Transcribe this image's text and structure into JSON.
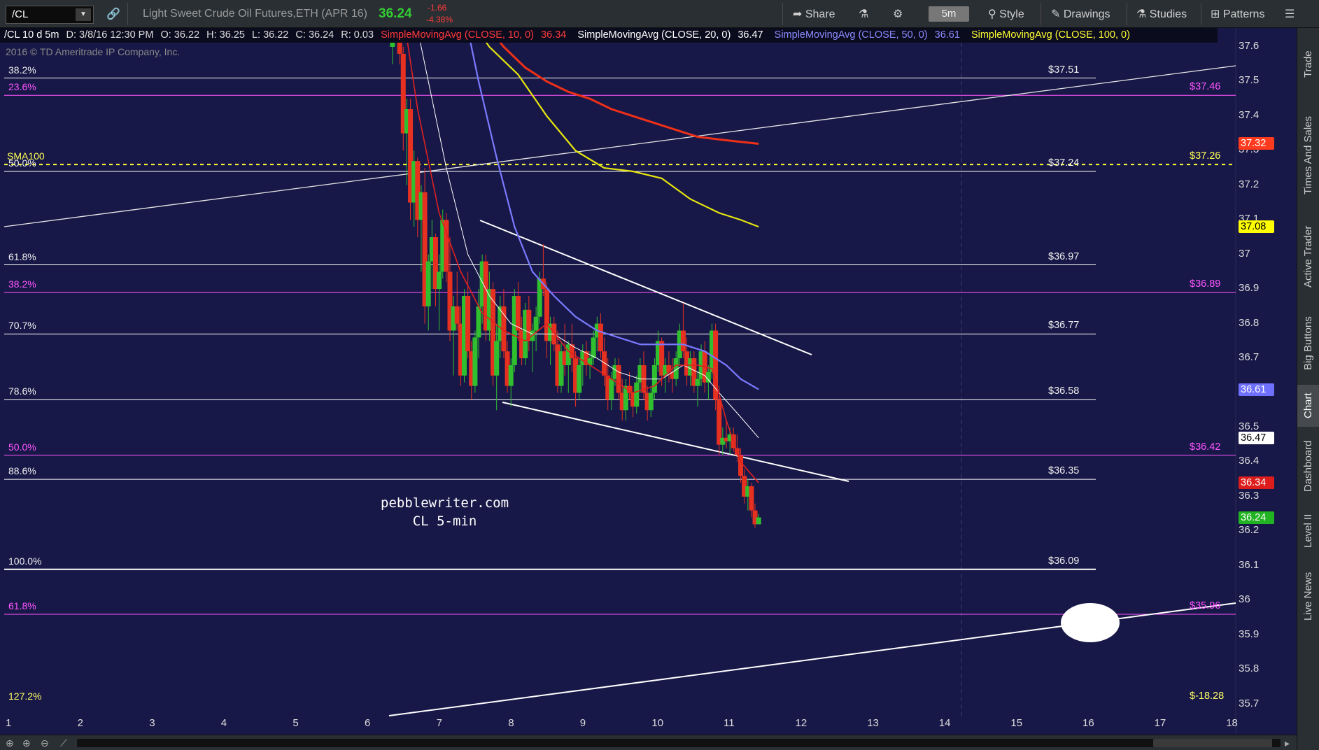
{
  "toolbar": {
    "symbol": "/CL",
    "instrument_name": "Light Sweet Crude Oil Futures,ETH (APR 16)",
    "last_price": "36.24",
    "net_change": "-1.66",
    "pct_change": "-4.38%",
    "share_label": "Share",
    "timeframe": "5m",
    "style_label": "Style",
    "drawings_label": "Drawings",
    "studies_label": "Studies",
    "patterns_label": "Patterns"
  },
  "header": {
    "symbol_period": "/CL 10 d 5m",
    "date": "D: 3/8/16 12:30 PM",
    "open": "O: 36.22",
    "high": "H: 36.25",
    "low": "L: 36.22",
    "close": "C: 36.24",
    "range": "R: 0.03",
    "studies": [
      {
        "label": "SimpleMovingAvg (CLOSE, 10, 0)",
        "value": "36.34",
        "color": "#ff2b2b"
      },
      {
        "label": "SimpleMovingAvg (CLOSE, 20, 0)",
        "value": "36.47",
        "color": "#ffffff"
      },
      {
        "label": "SimpleMovingAvg (CLOSE, 50, 0)",
        "value": "36.61",
        "color": "#8080ff"
      },
      {
        "label": "SimpleMovingAvg (CLOSE, 100, 0)",
        "value": "",
        "color": "#ffff00"
      }
    ]
  },
  "copyright": "2016 © TD Ameritrade IP Company, Inc.",
  "watermark": {
    "line1": "pebblewriter.com",
    "line2": "CL 5-min"
  },
  "fib_levels": [
    {
      "label": "38.2%",
      "price_label": "$37.51",
      "price": 37.51,
      "color": "#ffffff"
    },
    {
      "label": "23.6%",
      "price_label": "$37.46",
      "price": 37.46,
      "color": "#ff55ff"
    },
    {
      "label": "50.0%",
      "price_label": "$37.24",
      "price": 37.24,
      "color": "#ffffff"
    },
    {
      "label": "61.8%",
      "price_label": "$36.97",
      "price": 36.97,
      "color": "#ffffff"
    },
    {
      "label": "38.2%",
      "price_label": "$36.89",
      "price": 36.89,
      "color": "#ff55ff"
    },
    {
      "label": "70.7%",
      "price_label": "$36.77",
      "price": 36.77,
      "color": "#ffffff"
    },
    {
      "label": "78.6%",
      "price_label": "$36.58",
      "price": 36.58,
      "color": "#ffffff"
    },
    {
      "label": "50.0%",
      "price_label": "$36.42",
      "price": 36.42,
      "color": "#ff55ff"
    },
    {
      "label": "88.6%",
      "price_label": "$36.35",
      "price": 36.35,
      "color": "#ffffff"
    },
    {
      "label": "100.0%",
      "price_label": "$36.09",
      "price": 36.09,
      "color": "#ffffff"
    },
    {
      "label": "61.8%",
      "price_label": "$35.96",
      "price": 35.96,
      "color": "#ff55ff"
    },
    {
      "label": "127.2%",
      "price_label": "$-18.28",
      "price": 35.7,
      "color": "#ffff66"
    }
  ],
  "sma100_tag": {
    "label": "SMA100",
    "price_label": "$37.26",
    "price": 37.26
  },
  "y_axis": [
    "37.6",
    "37.5",
    "37.4",
    "37.3",
    "37.2",
    "37.1",
    "37",
    "36.9",
    "36.8",
    "36.7",
    "36.6",
    "36.5",
    "36.4",
    "36.3",
    "36.2",
    "36.1",
    "36",
    "35.9",
    "35.8",
    "35.7"
  ],
  "x_axis": [
    "1",
    "2",
    "3",
    "4",
    "5",
    "6",
    "7",
    "8",
    "9",
    "10",
    "11",
    "12",
    "13",
    "14",
    "15",
    "16",
    "17",
    "18"
  ],
  "axis_tags": [
    {
      "value": "37.32",
      "bg": "#ff3b1f",
      "fg": "#ffffff"
    },
    {
      "value": "37.08",
      "bg": "#ffff00",
      "fg": "#000000"
    },
    {
      "value": "36.61",
      "bg": "#7070ff",
      "fg": "#ffffff"
    },
    {
      "value": "36.47",
      "bg": "#ffffff",
      "fg": "#000000"
    },
    {
      "value": "36.34",
      "bg": "#dd1c1c",
      "fg": "#ffffff"
    },
    {
      "value": "36.24",
      "bg": "#22b322",
      "fg": "#ffffff"
    }
  ],
  "side_tabs": [
    "Trade",
    "Times And Sales",
    "Active Trader",
    "Big Buttons",
    "Chart",
    "Dashboard",
    "Level II",
    "Live News"
  ],
  "chart_data": {
    "type": "candlestick",
    "x_unit": "hour",
    "ylim": [
      35.7,
      37.65
    ],
    "candles": [
      [
        6.35,
        37.6,
        37.66,
        37.55,
        37.62
      ],
      [
        6.45,
        37.62,
        37.66,
        37.55,
        37.58
      ],
      [
        6.5,
        37.58,
        37.6,
        37.3,
        37.35
      ],
      [
        6.55,
        37.35,
        37.45,
        37.2,
        37.42
      ],
      [
        6.6,
        37.42,
        37.45,
        37.1,
        37.15
      ],
      [
        6.65,
        37.15,
        37.3,
        37.08,
        37.27
      ],
      [
        6.7,
        37.27,
        37.28,
        37.05,
        37.1
      ],
      [
        6.75,
        37.1,
        37.2,
        36.95,
        37.18
      ],
      [
        6.8,
        37.18,
        37.25,
        36.8,
        36.85
      ],
      [
        6.85,
        36.85,
        37.0,
        36.78,
        36.98
      ],
      [
        6.9,
        36.98,
        37.1,
        36.9,
        37.05
      ],
      [
        6.95,
        37.05,
        37.06,
        36.85,
        36.9
      ],
      [
        7.0,
        36.9,
        37.0,
        36.78,
        36.95
      ],
      [
        7.05,
        36.95,
        37.13,
        36.93,
        37.1
      ],
      [
        7.1,
        37.1,
        37.12,
        36.92,
        36.95
      ],
      [
        7.15,
        36.95,
        37.05,
        36.75,
        36.78
      ],
      [
        7.2,
        36.78,
        36.88,
        36.65,
        36.85
      ],
      [
        7.25,
        36.85,
        36.95,
        36.78,
        36.8
      ],
      [
        7.3,
        36.8,
        36.85,
        36.62,
        36.65
      ],
      [
        7.35,
        36.65,
        36.9,
        36.63,
        36.88
      ],
      [
        7.4,
        36.88,
        36.95,
        36.7,
        36.72
      ],
      [
        7.45,
        36.72,
        36.75,
        36.58,
        36.62
      ],
      [
        7.5,
        36.62,
        36.78,
        36.6,
        36.76
      ],
      [
        7.55,
        36.76,
        36.9,
        36.7,
        36.85
      ],
      [
        7.6,
        36.85,
        37.0,
        36.8,
        36.98
      ],
      [
        7.65,
        36.98,
        37.0,
        36.75,
        36.78
      ],
      [
        7.7,
        36.78,
        36.95,
        36.75,
        36.9
      ],
      [
        7.75,
        36.9,
        36.92,
        36.62,
        36.65
      ],
      [
        7.8,
        36.65,
        36.8,
        36.55,
        36.75
      ],
      [
        7.85,
        36.75,
        36.88,
        36.7,
        36.85
      ],
      [
        7.9,
        36.85,
        36.9,
        36.7,
        36.72
      ],
      [
        7.95,
        36.72,
        36.75,
        36.6,
        36.62
      ],
      [
        8.0,
        36.62,
        36.7,
        36.56,
        36.68
      ],
      [
        8.05,
        36.68,
        36.9,
        36.66,
        36.88
      ],
      [
        8.1,
        36.88,
        36.92,
        36.75,
        36.78
      ],
      [
        8.15,
        36.78,
        36.82,
        36.68,
        36.7
      ],
      [
        8.2,
        36.7,
        36.86,
        36.68,
        36.84
      ],
      [
        8.25,
        36.84,
        36.88,
        36.72,
        36.75
      ],
      [
        8.3,
        36.75,
        36.8,
        36.66,
        36.78
      ],
      [
        8.35,
        36.78,
        36.85,
        36.72,
        36.82
      ],
      [
        8.4,
        36.82,
        36.95,
        36.8,
        36.93
      ],
      [
        8.45,
        36.93,
        37.03,
        36.88,
        36.9
      ],
      [
        8.5,
        36.9,
        36.92,
        36.7,
        36.75
      ],
      [
        8.55,
        36.75,
        36.82,
        36.68,
        36.8
      ],
      [
        8.6,
        36.8,
        36.82,
        36.72,
        36.74
      ],
      [
        8.65,
        36.74,
        36.78,
        36.6,
        36.62
      ],
      [
        8.7,
        36.62,
        36.75,
        36.6,
        36.72
      ],
      [
        8.75,
        36.72,
        36.8,
        36.65,
        36.68
      ],
      [
        8.8,
        36.68,
        36.75,
        36.6,
        36.74
      ],
      [
        8.85,
        36.74,
        36.8,
        36.66,
        36.7
      ],
      [
        8.9,
        36.7,
        36.72,
        36.56,
        36.6
      ],
      [
        8.95,
        36.6,
        36.7,
        36.58,
        36.68
      ],
      [
        9.0,
        36.68,
        36.74,
        36.62,
        36.72
      ],
      [
        9.05,
        36.72,
        36.75,
        36.65,
        36.68
      ],
      [
        9.1,
        36.68,
        36.72,
        36.64,
        36.7
      ],
      [
        9.15,
        36.7,
        36.78,
        36.68,
        36.76
      ],
      [
        9.2,
        36.76,
        36.82,
        36.72,
        36.8
      ],
      [
        9.25,
        36.8,
        36.83,
        36.7,
        36.72
      ],
      [
        9.3,
        36.72,
        36.76,
        36.62,
        36.65
      ],
      [
        9.35,
        36.65,
        36.7,
        36.55,
        36.58
      ],
      [
        9.4,
        36.58,
        36.66,
        36.55,
        36.64
      ],
      [
        9.45,
        36.64,
        36.7,
        36.62,
        36.68
      ],
      [
        9.5,
        36.68,
        36.7,
        36.58,
        36.6
      ],
      [
        9.55,
        36.6,
        36.64,
        36.52,
        36.55
      ],
      [
        9.6,
        36.55,
        36.64,
        36.52,
        36.62
      ],
      [
        9.65,
        36.62,
        36.66,
        36.58,
        36.6
      ],
      [
        9.7,
        36.6,
        36.62,
        36.53,
        36.56
      ],
      [
        9.75,
        36.56,
        36.65,
        36.54,
        36.63
      ],
      [
        9.8,
        36.63,
        36.7,
        36.6,
        36.68
      ],
      [
        9.85,
        36.68,
        36.72,
        36.58,
        36.6
      ],
      [
        9.9,
        36.6,
        36.62,
        36.52,
        36.55
      ],
      [
        9.95,
        36.55,
        36.62,
        36.53,
        36.6
      ],
      [
        10.0,
        36.6,
        36.7,
        36.58,
        36.68
      ],
      [
        10.05,
        36.68,
        36.78,
        36.66,
        36.75
      ],
      [
        10.1,
        36.75,
        36.76,
        36.62,
        36.65
      ],
      [
        10.15,
        36.65,
        36.7,
        36.6,
        36.68
      ],
      [
        10.2,
        36.68,
        36.72,
        36.63,
        36.66
      ],
      [
        10.25,
        36.66,
        36.7,
        36.6,
        36.64
      ],
      [
        10.3,
        36.64,
        36.72,
        36.62,
        36.7
      ],
      [
        10.35,
        36.7,
        36.8,
        36.68,
        36.78
      ],
      [
        10.4,
        36.78,
        36.86,
        36.7,
        36.72
      ],
      [
        10.45,
        36.72,
        36.76,
        36.62,
        36.65
      ],
      [
        10.5,
        36.65,
        36.72,
        36.62,
        36.7
      ],
      [
        10.55,
        36.7,
        36.72,
        36.6,
        36.62
      ],
      [
        10.6,
        36.62,
        36.66,
        36.56,
        36.64
      ],
      [
        10.65,
        36.64,
        36.74,
        36.62,
        36.72
      ],
      [
        10.7,
        36.72,
        36.75,
        36.6,
        36.63
      ],
      [
        10.75,
        36.63,
        36.68,
        36.58,
        36.66
      ],
      [
        10.8,
        36.66,
        36.8,
        36.64,
        36.78
      ],
      [
        10.85,
        36.78,
        36.8,
        36.55,
        36.58
      ],
      [
        10.9,
        36.58,
        36.62,
        36.42,
        36.45
      ],
      [
        10.95,
        36.45,
        36.5,
        36.42,
        36.47
      ],
      [
        11.0,
        36.47,
        36.52,
        36.44,
        36.46
      ],
      [
        11.05,
        36.46,
        36.5,
        36.42,
        36.48
      ],
      [
        11.1,
        36.48,
        36.5,
        36.43,
        36.44
      ],
      [
        11.15,
        36.44,
        36.48,
        36.4,
        36.42
      ],
      [
        11.2,
        36.42,
        36.44,
        36.34,
        36.36
      ],
      [
        11.25,
        36.36,
        36.38,
        36.28,
        36.3
      ],
      [
        11.3,
        36.3,
        36.35,
        36.26,
        36.33
      ],
      [
        11.35,
        36.33,
        36.34,
        36.24,
        36.26
      ],
      [
        11.4,
        36.26,
        36.28,
        36.21,
        36.22
      ],
      [
        11.45,
        36.22,
        36.25,
        36.22,
        36.24
      ]
    ],
    "sma10": [
      [
        6.35,
        37.9
      ],
      [
        6.7,
        37.42
      ],
      [
        7.0,
        37.12
      ],
      [
        7.3,
        36.95
      ],
      [
        7.6,
        36.83
      ],
      [
        7.9,
        36.78
      ],
      [
        8.2,
        36.75
      ],
      [
        8.5,
        36.8
      ],
      [
        8.8,
        36.72
      ],
      [
        9.1,
        36.68
      ],
      [
        9.4,
        36.64
      ],
      [
        9.7,
        36.6
      ],
      [
        10.0,
        36.62
      ],
      [
        10.3,
        36.68
      ],
      [
        10.6,
        36.68
      ],
      [
        10.8,
        36.67
      ],
      [
        11.0,
        36.52
      ],
      [
        11.2,
        36.4
      ],
      [
        11.45,
        36.34
      ]
    ],
    "sma20": [
      [
        6.45,
        37.9
      ],
      [
        6.8,
        37.55
      ],
      [
        7.1,
        37.25
      ],
      [
        7.4,
        37.0
      ],
      [
        7.7,
        36.88
      ],
      [
        8.0,
        36.8
      ],
      [
        8.3,
        36.77
      ],
      [
        8.6,
        36.77
      ],
      [
        8.9,
        36.73
      ],
      [
        9.2,
        36.7
      ],
      [
        9.5,
        36.66
      ],
      [
        9.8,
        36.64
      ],
      [
        10.1,
        36.64
      ],
      [
        10.4,
        36.68
      ],
      [
        10.7,
        36.65
      ],
      [
        10.9,
        36.6
      ],
      [
        11.2,
        36.53
      ],
      [
        11.45,
        36.47
      ]
    ],
    "sma50": [
      [
        7.3,
        37.75
      ],
      [
        7.55,
        37.5
      ],
      [
        7.8,
        37.28
      ],
      [
        8.05,
        37.08
      ],
      [
        8.3,
        36.95
      ],
      [
        8.6,
        36.88
      ],
      [
        8.9,
        36.82
      ],
      [
        9.2,
        36.78
      ],
      [
        9.5,
        36.76
      ],
      [
        9.8,
        36.74
      ],
      [
        10.1,
        36.74
      ],
      [
        10.4,
        36.74
      ],
      [
        10.7,
        36.72
      ],
      [
        11.0,
        36.68
      ],
      [
        11.2,
        36.64
      ],
      [
        11.45,
        36.61
      ]
    ],
    "sma100": [
      [
        7.3,
        37.72
      ],
      [
        7.7,
        37.6
      ],
      [
        8.1,
        37.52
      ],
      [
        8.5,
        37.4
      ],
      [
        8.9,
        37.3
      ],
      [
        9.3,
        37.25
      ],
      [
        9.7,
        37.24
      ],
      [
        10.1,
        37.22
      ],
      [
        10.5,
        37.16
      ],
      [
        10.9,
        37.12
      ],
      [
        11.2,
        37.1
      ],
      [
        11.45,
        37.08
      ]
    ],
    "sma_red_long": [
      [
        7.3,
        37.75
      ],
      [
        7.6,
        37.68
      ],
      [
        7.9,
        37.6
      ],
      [
        8.2,
        37.54
      ],
      [
        8.5,
        37.5
      ],
      [
        8.8,
        37.47
      ],
      [
        9.1,
        37.45
      ],
      [
        9.4,
        37.42
      ],
      [
        9.7,
        37.4
      ],
      [
        10.0,
        37.38
      ],
      [
        10.3,
        37.36
      ],
      [
        10.6,
        37.34
      ],
      [
        11.0,
        37.33
      ],
      [
        11.45,
        37.32
      ]
    ]
  }
}
